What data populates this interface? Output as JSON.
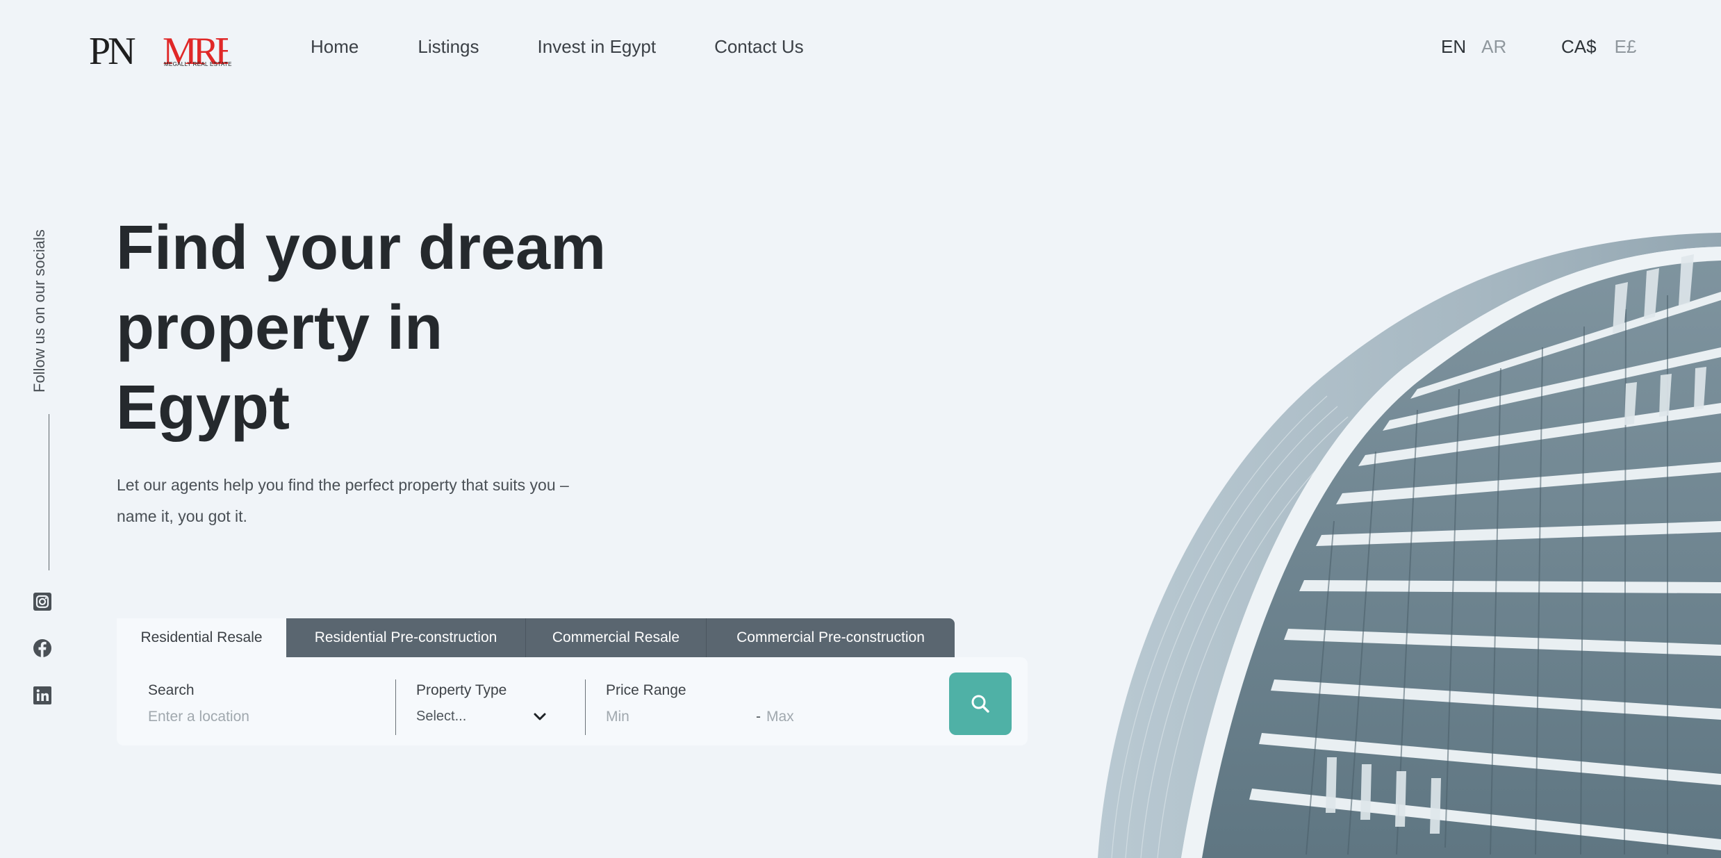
{
  "header": {
    "logo": {
      "mark_left": "PN",
      "mark_right": "MRE",
      "tagline": "MEGALLY REAL ESTATE"
    },
    "nav": [
      {
        "label": "Home"
      },
      {
        "label": "Listings"
      },
      {
        "label": "Invest in Egypt"
      },
      {
        "label": "Contact Us"
      }
    ],
    "language": {
      "active": "EN",
      "inactive": "AR"
    },
    "currency": {
      "active": "CA$",
      "inactive": "E£"
    }
  },
  "socials": {
    "label": "Follow us on our socials",
    "icons": [
      "instagram-icon",
      "facebook-icon",
      "linkedin-icon"
    ]
  },
  "hero": {
    "title_lines": [
      "Find your dream",
      "property in",
      "Egypt"
    ],
    "subtitle_lines": [
      "Let our agents help you find the perfect property that suits you –",
      "name it, you got it."
    ]
  },
  "search": {
    "tabs": [
      {
        "label": "Residential Resale",
        "active": true
      },
      {
        "label": "Residential Pre-construction",
        "active": false
      },
      {
        "label": "Commercial Resale",
        "active": false
      },
      {
        "label": "Commercial Pre-construction",
        "active": false
      }
    ],
    "location": {
      "label": "Search",
      "placeholder": "Enter a location"
    },
    "property_type": {
      "label": "Property Type",
      "selected": "Select..."
    },
    "price": {
      "label": "Price Range",
      "min_placeholder": "Min",
      "separator": "-",
      "max_placeholder": "Max"
    },
    "button_icon": "search-icon"
  },
  "colors": {
    "background": "#f0f4f8",
    "accent": "#4fb1a6",
    "tab_dark": "#5a6670",
    "logo_red": "#e02828"
  }
}
